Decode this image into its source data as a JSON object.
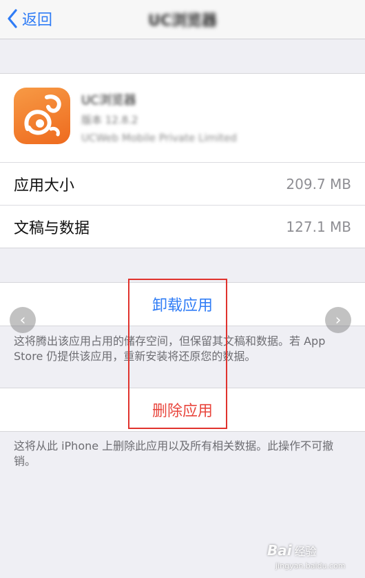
{
  "nav": {
    "back_label": "返回",
    "title": "UC浏览器"
  },
  "app": {
    "name": "UC浏览器",
    "version": "版本 12.8.2",
    "vendor": "UCWeb Mobile Private Limited"
  },
  "storage": {
    "rows": [
      {
        "label": "应用大小",
        "value": "209.7 MB"
      },
      {
        "label": "文稿与数据",
        "value": "127.1 MB"
      }
    ]
  },
  "actions": {
    "offload_label": "卸载应用",
    "offload_note": "这将腾出该应用占用的储存空间，但保留其文稿和数据。若 App Store 仍提供该应用，重新安装将还原您的数据。",
    "delete_label": "删除应用",
    "delete_note": "这将从此 iPhone 上删除此应用以及所有相关数据。此操作不可撤销。"
  },
  "carousel": {
    "prev_glyph": "‹",
    "next_glyph": "›"
  },
  "watermark": {
    "brand": "Bai",
    "suffix": "经验",
    "url": "jingyan.baidu.com"
  },
  "colors": {
    "accent_blue": "#2f7cf6",
    "destructive_red": "#e8453c",
    "highlight_red": "#e0322d",
    "app_icon_orange": "#f07a2a"
  },
  "icons": {
    "back": "chevron-left-icon",
    "app": "uc-browser-squirrel-icon",
    "prev": "chevron-left-icon",
    "next": "chevron-right-icon"
  }
}
